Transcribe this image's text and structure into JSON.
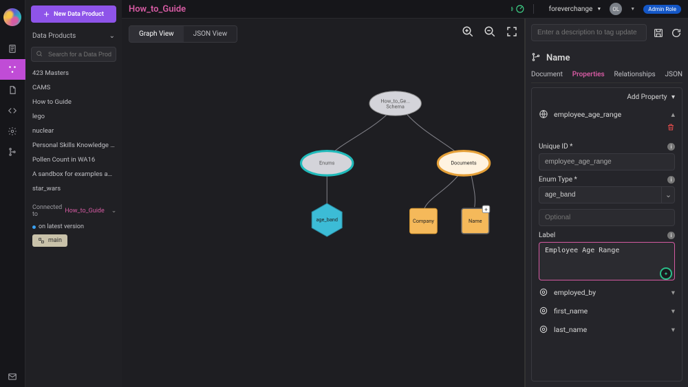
{
  "header": {
    "title": "How_to_Guide",
    "user": "foreverchange",
    "avatarInitials": "OL",
    "role": "Admin Role"
  },
  "newButton": "New Data Product",
  "sidebar": {
    "heading": "Data Products",
    "searchPlaceholder": "Search for a Data Product",
    "items": [
      "423 Masters",
      "CAMS",
      "How to Guide",
      "lego",
      "nuclear",
      "Personal Skills Knowledge Gr...",
      "Pollen Count in WA16",
      "A sandbox for examples and r...",
      "star_wars"
    ],
    "connectedPrefix": "Connected to ",
    "connectedName": "How_to_Guide",
    "latest": "on latest version",
    "branch": "main"
  },
  "tabs": {
    "graph": "Graph View",
    "json": "JSON View"
  },
  "graph": {
    "root": "How_to_Ge...\nSchema",
    "enums": "Enums",
    "docs": "Documents",
    "ageband": "age_band",
    "company": "Company",
    "name": "Name",
    "plus": "+"
  },
  "right": {
    "descPlaceholder": "Enter a description to tag update",
    "title": "Name",
    "tabs": [
      "Document",
      "Properties",
      "Relationships",
      "JSON"
    ],
    "addProp": "Add Property",
    "expanded": {
      "name": "employee_age_range",
      "uniqueIdLabel": "Unique ID *",
      "uniqueIdValue": "employee_age_range",
      "enumTypeLabel": "Enum Type *",
      "enumTypeValue": "age_band",
      "optionalPlaceholder": "Optional",
      "labelLabel": "Label",
      "labelValue": "Employee Age Range"
    },
    "collapsed": [
      "employed_by",
      "first_name",
      "last_name"
    ]
  }
}
